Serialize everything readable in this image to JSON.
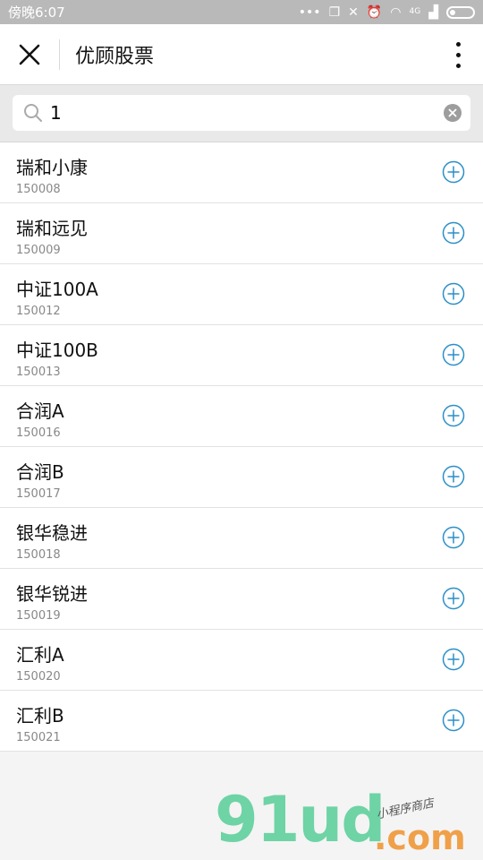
{
  "status_bar": {
    "time": "傍晚6:07",
    "network_label": "4G"
  },
  "nav": {
    "title": "优顾股票"
  },
  "search": {
    "value": "1"
  },
  "stocks": [
    {
      "name": "瑞和小康",
      "code": "150008"
    },
    {
      "name": "瑞和远见",
      "code": "150009"
    },
    {
      "name": "中证100A",
      "code": "150012"
    },
    {
      "name": "中证100B",
      "code": "150013"
    },
    {
      "name": "合润A",
      "code": "150016"
    },
    {
      "name": "合润B",
      "code": "150017"
    },
    {
      "name": "银华稳进",
      "code": "150018"
    },
    {
      "name": "银华锐进",
      "code": "150019"
    },
    {
      "name": "汇利A",
      "code": "150020"
    },
    {
      "name": "汇利B",
      "code": "150021"
    }
  ],
  "watermark": {
    "main": "91ud",
    "suffix": ".com",
    "sub": "小程序商店"
  },
  "colors": {
    "accent": "#2b8fc7",
    "status_bar": "#b9b9b9"
  }
}
